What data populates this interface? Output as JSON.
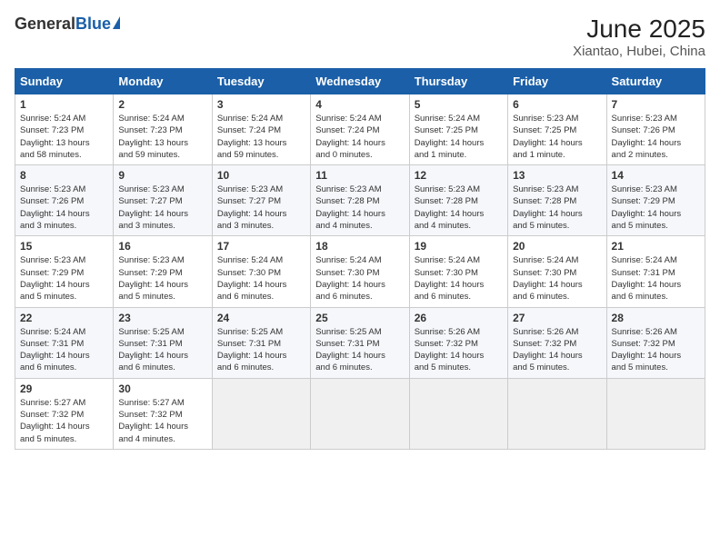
{
  "header": {
    "logo_general": "General",
    "logo_blue": "Blue",
    "title": "June 2025",
    "subtitle": "Xiantao, Hubei, China"
  },
  "calendar": {
    "columns": [
      "Sunday",
      "Monday",
      "Tuesday",
      "Wednesday",
      "Thursday",
      "Friday",
      "Saturday"
    ],
    "weeks": [
      [
        {
          "day": 1,
          "lines": [
            "Sunrise: 5:24 AM",
            "Sunset: 7:23 PM",
            "Daylight: 13 hours",
            "and 58 minutes."
          ]
        },
        {
          "day": 2,
          "lines": [
            "Sunrise: 5:24 AM",
            "Sunset: 7:23 PM",
            "Daylight: 13 hours",
            "and 59 minutes."
          ]
        },
        {
          "day": 3,
          "lines": [
            "Sunrise: 5:24 AM",
            "Sunset: 7:24 PM",
            "Daylight: 13 hours",
            "and 59 minutes."
          ]
        },
        {
          "day": 4,
          "lines": [
            "Sunrise: 5:24 AM",
            "Sunset: 7:24 PM",
            "Daylight: 14 hours",
            "and 0 minutes."
          ]
        },
        {
          "day": 5,
          "lines": [
            "Sunrise: 5:24 AM",
            "Sunset: 7:25 PM",
            "Daylight: 14 hours",
            "and 1 minute."
          ]
        },
        {
          "day": 6,
          "lines": [
            "Sunrise: 5:23 AM",
            "Sunset: 7:25 PM",
            "Daylight: 14 hours",
            "and 1 minute."
          ]
        },
        {
          "day": 7,
          "lines": [
            "Sunrise: 5:23 AM",
            "Sunset: 7:26 PM",
            "Daylight: 14 hours",
            "and 2 minutes."
          ]
        }
      ],
      [
        {
          "day": 8,
          "lines": [
            "Sunrise: 5:23 AM",
            "Sunset: 7:26 PM",
            "Daylight: 14 hours",
            "and 3 minutes."
          ]
        },
        {
          "day": 9,
          "lines": [
            "Sunrise: 5:23 AM",
            "Sunset: 7:27 PM",
            "Daylight: 14 hours",
            "and 3 minutes."
          ]
        },
        {
          "day": 10,
          "lines": [
            "Sunrise: 5:23 AM",
            "Sunset: 7:27 PM",
            "Daylight: 14 hours",
            "and 3 minutes."
          ]
        },
        {
          "day": 11,
          "lines": [
            "Sunrise: 5:23 AM",
            "Sunset: 7:28 PM",
            "Daylight: 14 hours",
            "and 4 minutes."
          ]
        },
        {
          "day": 12,
          "lines": [
            "Sunrise: 5:23 AM",
            "Sunset: 7:28 PM",
            "Daylight: 14 hours",
            "and 4 minutes."
          ]
        },
        {
          "day": 13,
          "lines": [
            "Sunrise: 5:23 AM",
            "Sunset: 7:28 PM",
            "Daylight: 14 hours",
            "and 5 minutes."
          ]
        },
        {
          "day": 14,
          "lines": [
            "Sunrise: 5:23 AM",
            "Sunset: 7:29 PM",
            "Daylight: 14 hours",
            "and 5 minutes."
          ]
        }
      ],
      [
        {
          "day": 15,
          "lines": [
            "Sunrise: 5:23 AM",
            "Sunset: 7:29 PM",
            "Daylight: 14 hours",
            "and 5 minutes."
          ]
        },
        {
          "day": 16,
          "lines": [
            "Sunrise: 5:23 AM",
            "Sunset: 7:29 PM",
            "Daylight: 14 hours",
            "and 5 minutes."
          ]
        },
        {
          "day": 17,
          "lines": [
            "Sunrise: 5:24 AM",
            "Sunset: 7:30 PM",
            "Daylight: 14 hours",
            "and 6 minutes."
          ]
        },
        {
          "day": 18,
          "lines": [
            "Sunrise: 5:24 AM",
            "Sunset: 7:30 PM",
            "Daylight: 14 hours",
            "and 6 minutes."
          ]
        },
        {
          "day": 19,
          "lines": [
            "Sunrise: 5:24 AM",
            "Sunset: 7:30 PM",
            "Daylight: 14 hours",
            "and 6 minutes."
          ]
        },
        {
          "day": 20,
          "lines": [
            "Sunrise: 5:24 AM",
            "Sunset: 7:30 PM",
            "Daylight: 14 hours",
            "and 6 minutes."
          ]
        },
        {
          "day": 21,
          "lines": [
            "Sunrise: 5:24 AM",
            "Sunset: 7:31 PM",
            "Daylight: 14 hours",
            "and 6 minutes."
          ]
        }
      ],
      [
        {
          "day": 22,
          "lines": [
            "Sunrise: 5:24 AM",
            "Sunset: 7:31 PM",
            "Daylight: 14 hours",
            "and 6 minutes."
          ]
        },
        {
          "day": 23,
          "lines": [
            "Sunrise: 5:25 AM",
            "Sunset: 7:31 PM",
            "Daylight: 14 hours",
            "and 6 minutes."
          ]
        },
        {
          "day": 24,
          "lines": [
            "Sunrise: 5:25 AM",
            "Sunset: 7:31 PM",
            "Daylight: 14 hours",
            "and 6 minutes."
          ]
        },
        {
          "day": 25,
          "lines": [
            "Sunrise: 5:25 AM",
            "Sunset: 7:31 PM",
            "Daylight: 14 hours",
            "and 6 minutes."
          ]
        },
        {
          "day": 26,
          "lines": [
            "Sunrise: 5:26 AM",
            "Sunset: 7:32 PM",
            "Daylight: 14 hours",
            "and 5 minutes."
          ]
        },
        {
          "day": 27,
          "lines": [
            "Sunrise: 5:26 AM",
            "Sunset: 7:32 PM",
            "Daylight: 14 hours",
            "and 5 minutes."
          ]
        },
        {
          "day": 28,
          "lines": [
            "Sunrise: 5:26 AM",
            "Sunset: 7:32 PM",
            "Daylight: 14 hours",
            "and 5 minutes."
          ]
        }
      ],
      [
        {
          "day": 29,
          "lines": [
            "Sunrise: 5:27 AM",
            "Sunset: 7:32 PM",
            "Daylight: 14 hours",
            "and 5 minutes."
          ]
        },
        {
          "day": 30,
          "lines": [
            "Sunrise: 5:27 AM",
            "Sunset: 7:32 PM",
            "Daylight: 14 hours",
            "and 4 minutes."
          ]
        },
        null,
        null,
        null,
        null,
        null
      ]
    ]
  }
}
